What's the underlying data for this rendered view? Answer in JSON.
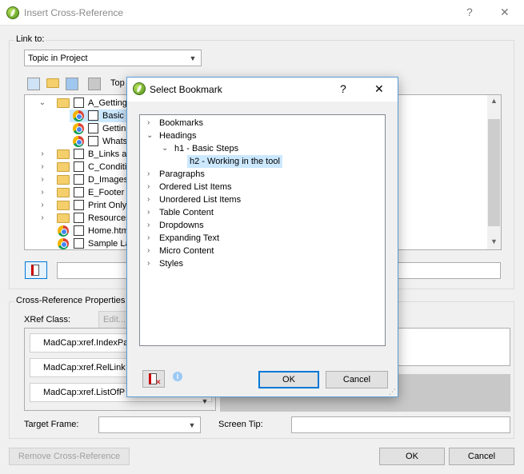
{
  "main": {
    "title": "Insert Cross-Reference",
    "help": "?",
    "close": "✕",
    "link_to_label": "Link to:",
    "link_to_value": "Topic in Project",
    "toolbar_text": "Top",
    "tree": [
      {
        "label": "A_Getting",
        "type": "folder",
        "expanded": true
      },
      {
        "label": "Basic S",
        "type": "topic",
        "selected": true
      },
      {
        "label": "Gettin",
        "type": "topic"
      },
      {
        "label": "Whats",
        "type": "topic"
      },
      {
        "label": "B_Links an",
        "type": "folder"
      },
      {
        "label": "C_Conditic",
        "type": "folder"
      },
      {
        "label": "D_Images",
        "type": "folder"
      },
      {
        "label": "E_Footer T",
        "type": "folder"
      },
      {
        "label": "Print Only",
        "type": "folder"
      },
      {
        "label": "Resources",
        "type": "folder"
      },
      {
        "label": "Home.htm",
        "type": "topic"
      },
      {
        "label": "Sample La",
        "type": "topic"
      }
    ],
    "xref_props_label": "Cross-Reference Properties",
    "xref_class_label": "XRef Class:",
    "edit_label": "Edit...",
    "xref_items": [
      "MadCap:xref.IndexPa",
      "MadCap:xref.RelLink",
      "MadCap:xref.ListOfP"
    ],
    "target_frame_label": "Target Frame:",
    "screen_tip_label": "Screen Tip:",
    "remove_label": "Remove Cross-Reference",
    "ok_label": "OK",
    "cancel_label": "Cancel"
  },
  "dialog": {
    "title": "Select Bookmark",
    "help": "?",
    "close": "✕",
    "tree": {
      "bookmarks": "Bookmarks",
      "headings": "Headings",
      "h1": "h1 - Basic Steps",
      "h2": "h2 - Working in the tool",
      "rest": [
        "Paragraphs",
        "Ordered List Items",
        "Unordered List Items",
        "Table Content",
        "Dropdowns",
        "Expanding Text",
        "Micro Content",
        "Styles"
      ]
    },
    "ok_label": "OK",
    "cancel_label": "Cancel",
    "info_icon": "i"
  }
}
